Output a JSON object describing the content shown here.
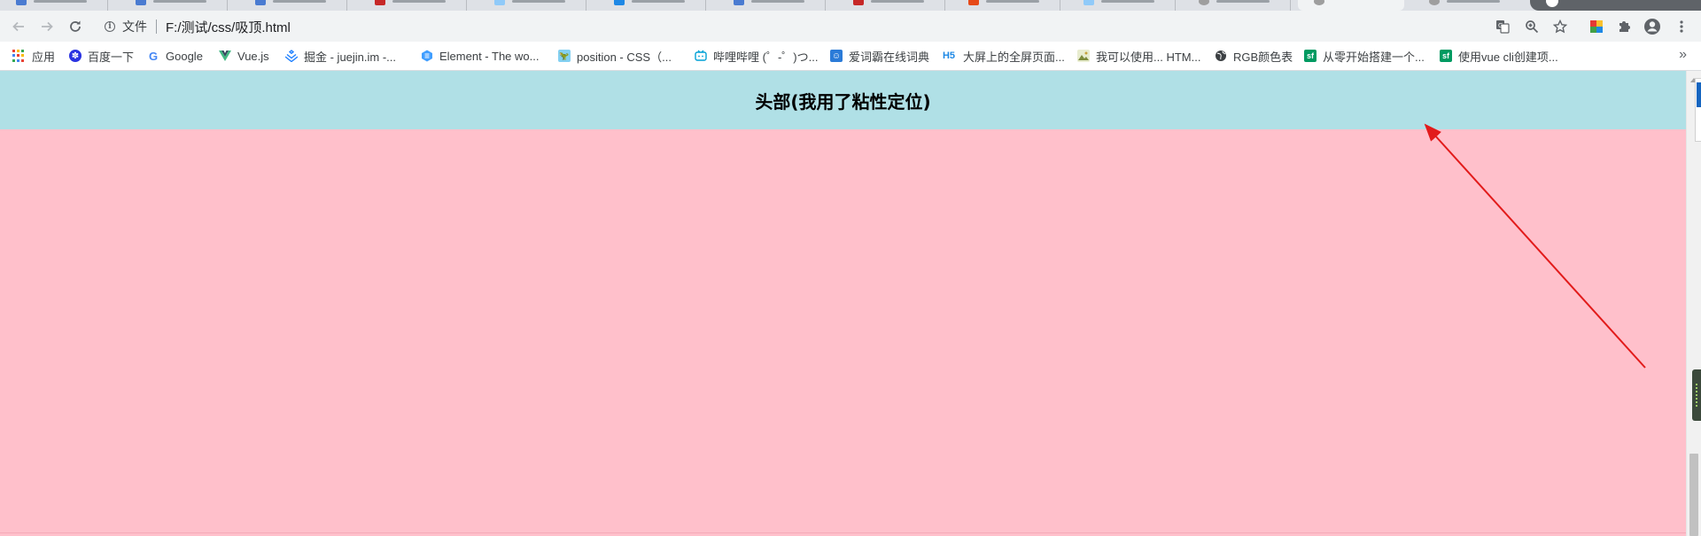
{
  "browser": {
    "address": {
      "security_chip": "文件",
      "url": "F:/测试/css/吸顶.html"
    },
    "nav": {
      "back_icon": "arrow-left-icon",
      "forward_icon": "arrow-right-icon",
      "reload_icon": "reload-icon"
    }
  },
  "bookmarks": [
    {
      "label": "应用",
      "icon": "apps-grid-icon"
    },
    {
      "label": "百度一下",
      "icon": "baidu-paw-icon",
      "color": "#2932e1"
    },
    {
      "label": "Google",
      "icon": "google-g-icon",
      "color": "#4285f4"
    },
    {
      "label": "Vue.js",
      "icon": "vue-logo-icon",
      "color": "#42b883"
    },
    {
      "label": "掘金 - juejin.im -...",
      "icon": "juejin-logo-icon",
      "color": "#1e80ff"
    },
    {
      "label": "Element - The wo...",
      "icon": "element-logo-icon",
      "color": "#409eff"
    },
    {
      "label": "position - CSS（...",
      "icon": "mdn-logo-icon",
      "color": "#1f4e79"
    },
    {
      "label": "哔哩哔哩 (゜-゜)つ...",
      "icon": "bilibili-tv-icon",
      "color": "#00a1d6"
    },
    {
      "label": "爱词霸在线词典",
      "icon": "iciba-logo-icon",
      "color": "#2b7bd8"
    },
    {
      "label": "大屏上的全屏页面...",
      "icon": "h5-logo-icon",
      "color": "#1e88e5"
    },
    {
      "label": "我可以使用... HTM...",
      "icon": "caniuse-image-icon",
      "color": "#8a9a5b"
    },
    {
      "label": "RGB颜色表",
      "icon": "globe-icon",
      "color": "#3c4043"
    },
    {
      "label": "从零开始搭建一个...",
      "icon": "sf-logo-icon",
      "color": "#009a61"
    },
    {
      "label": "使用vue cli创建项...",
      "icon": "sf-logo-icon",
      "color": "#009a61"
    }
  ],
  "page": {
    "header_text": "头部(我用了粘性定位)",
    "header_bg": "#b0e0e6",
    "body_bg": "#ffc0cb"
  },
  "annotation": {
    "arrow_color": "#e21b1b"
  }
}
